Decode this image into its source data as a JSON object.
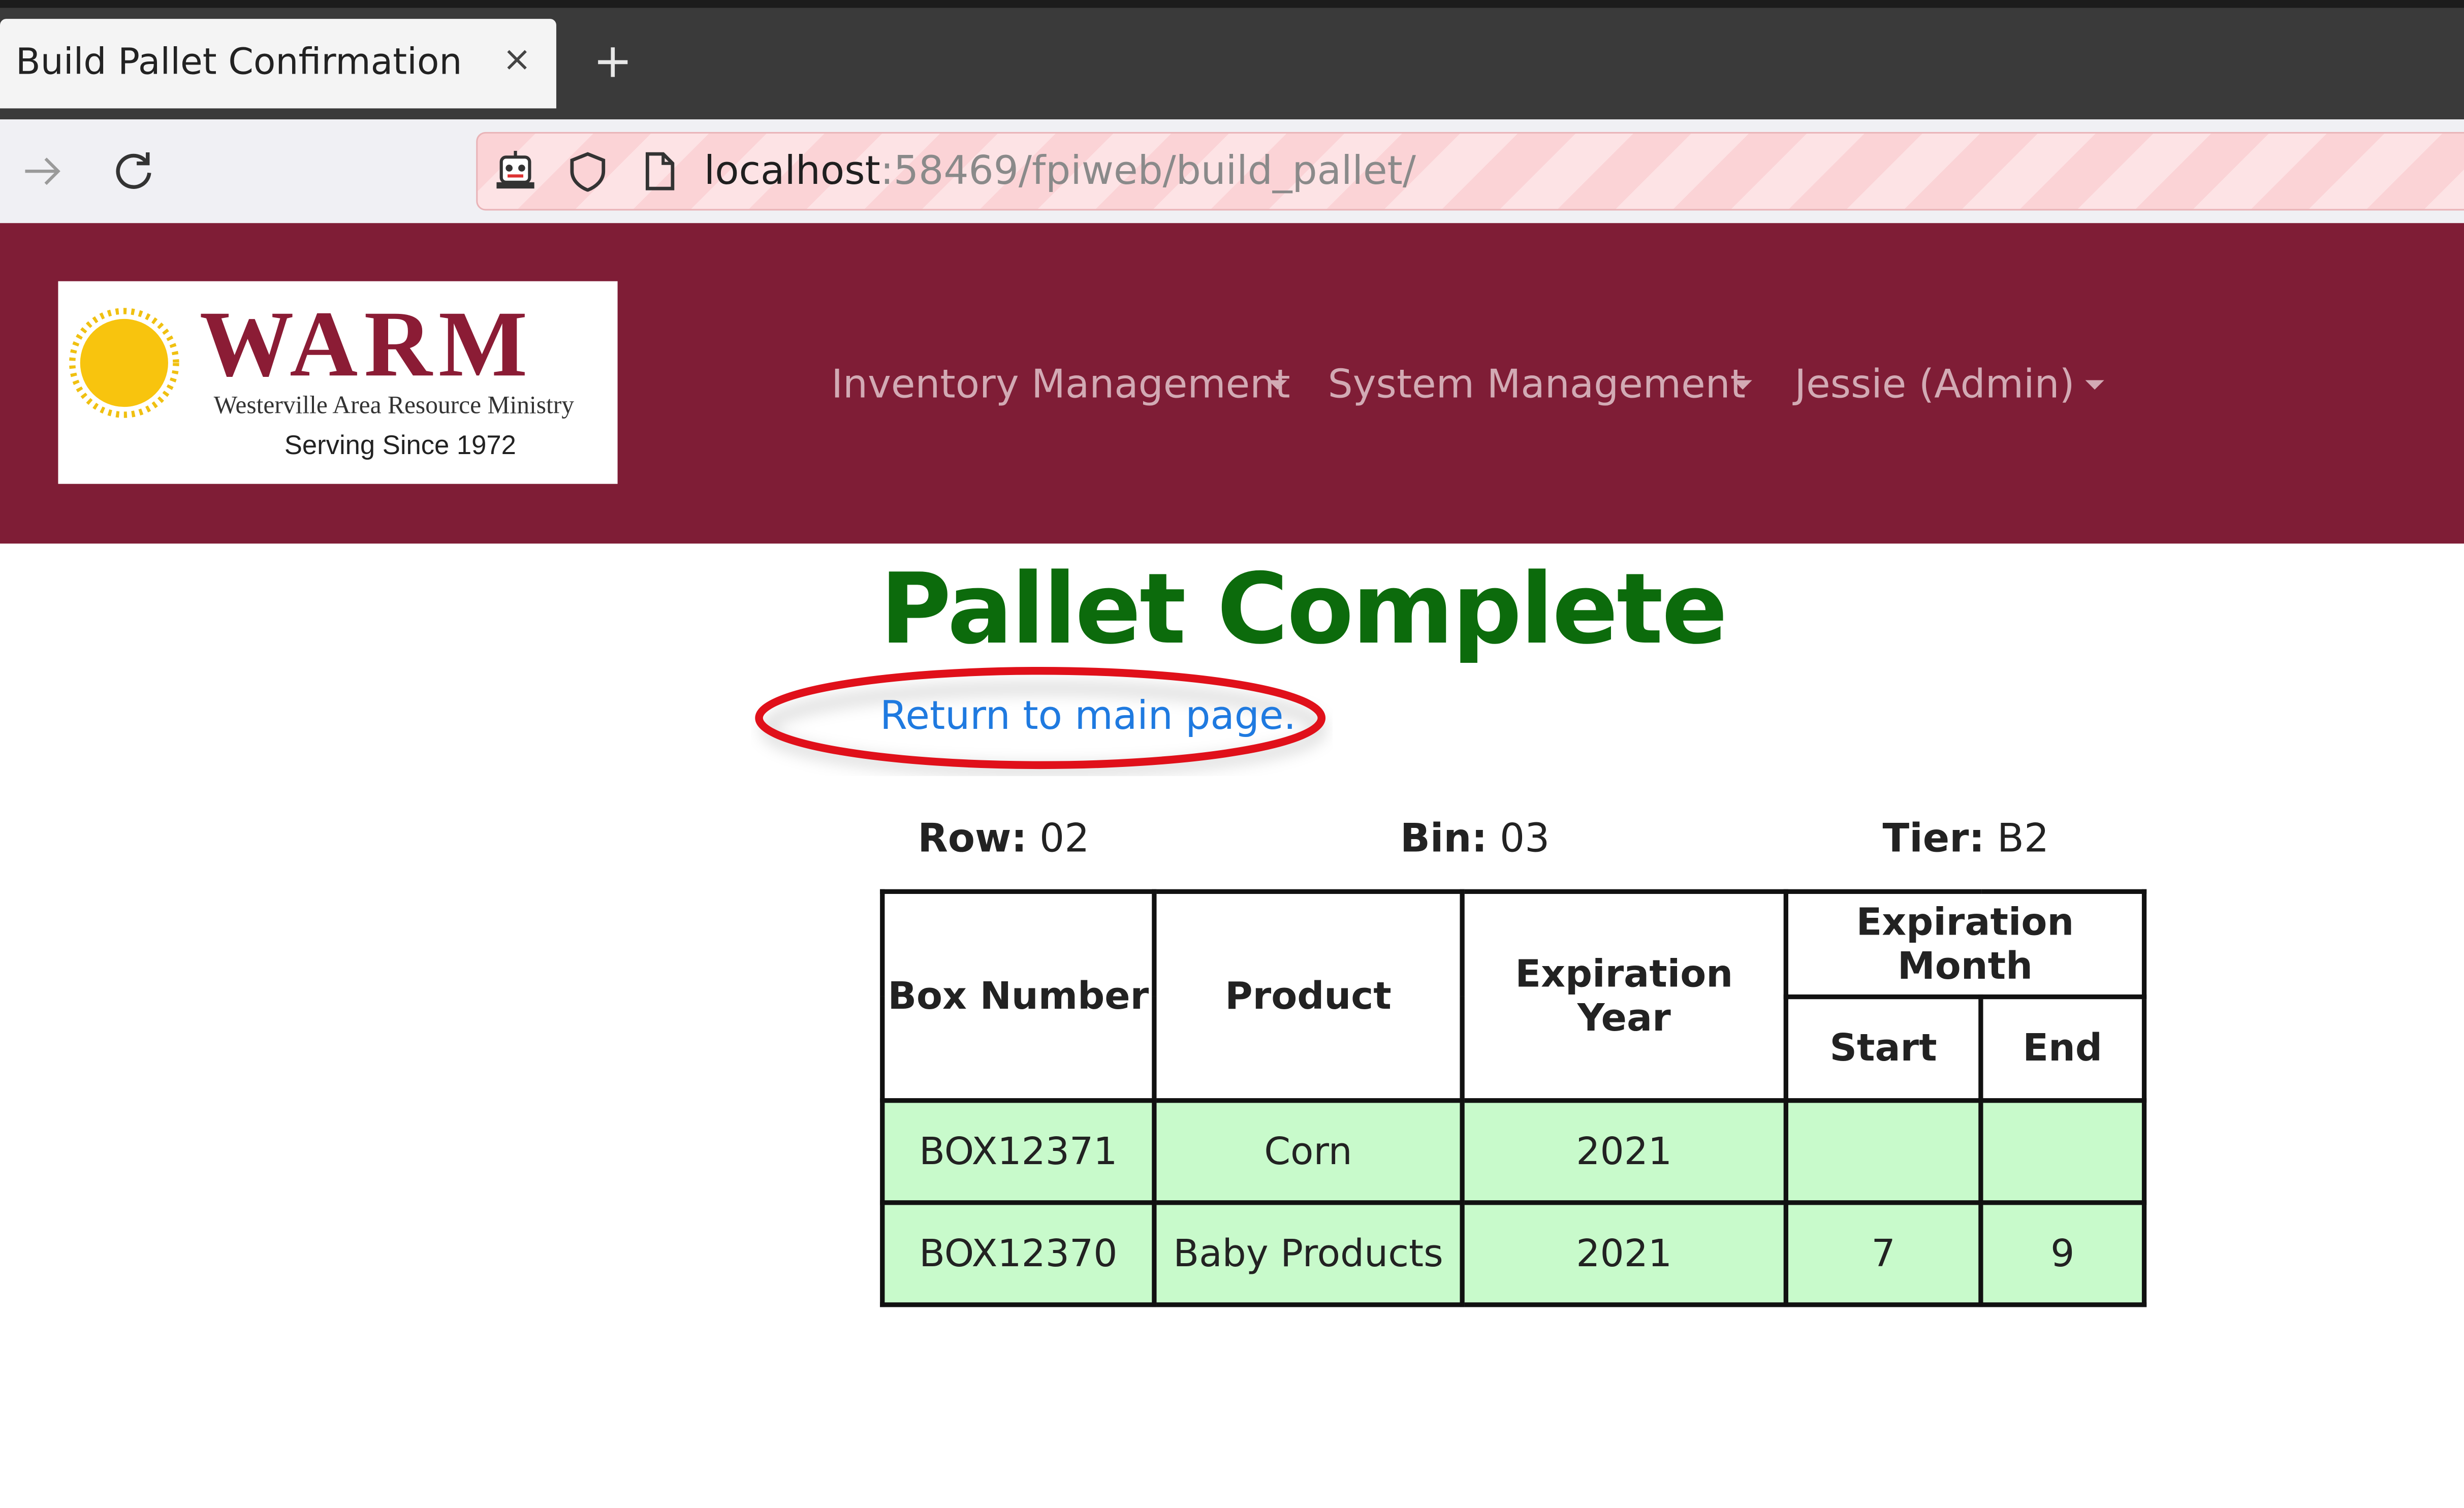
{
  "browser": {
    "tab_title": "Build Pallet Confirmation",
    "tab_close": "×",
    "new_tab": "+",
    "url_host": "localhost",
    "url_rest": ":58469/fpiweb/build_pallet/"
  },
  "header": {
    "logo": {
      "name": "WARM",
      "subtitle": "Westerville Area Resource Ministry",
      "tagline": "Serving Since 1972"
    },
    "menu": [
      {
        "label": "Inventory Management"
      },
      {
        "label": "System Management"
      },
      {
        "label": "Jessie (Admin)"
      }
    ],
    "colors": {
      "brand": "#7f1d36",
      "menu_text": "#d2aab4"
    }
  },
  "main": {
    "title": "Pallet Complete",
    "return_link": "Return to main page.",
    "location": {
      "row_label": "Row:",
      "row_value": "02",
      "bin_label": "Bin:",
      "bin_value": "03",
      "tier_label": "Tier:",
      "tier_value": "B2"
    },
    "table": {
      "headers": {
        "box_number": "Box Number",
        "product": "Product",
        "expiration_year": "Expiration Year",
        "expiration_month": "Expiration Month",
        "start": "Start",
        "end": "End"
      },
      "rows": [
        {
          "box_number": "BOX12371",
          "product": "Corn",
          "expiration_year": "2021",
          "start": "",
          "end": ""
        },
        {
          "box_number": "BOX12370",
          "product": "Baby Products",
          "expiration_year": "2021",
          "start": "7",
          "end": "9"
        }
      ]
    },
    "colors": {
      "title": "#0c6b0c",
      "link": "#1f7ae0",
      "row_bg": "#c8facb",
      "annotation": "#e0101a"
    }
  }
}
